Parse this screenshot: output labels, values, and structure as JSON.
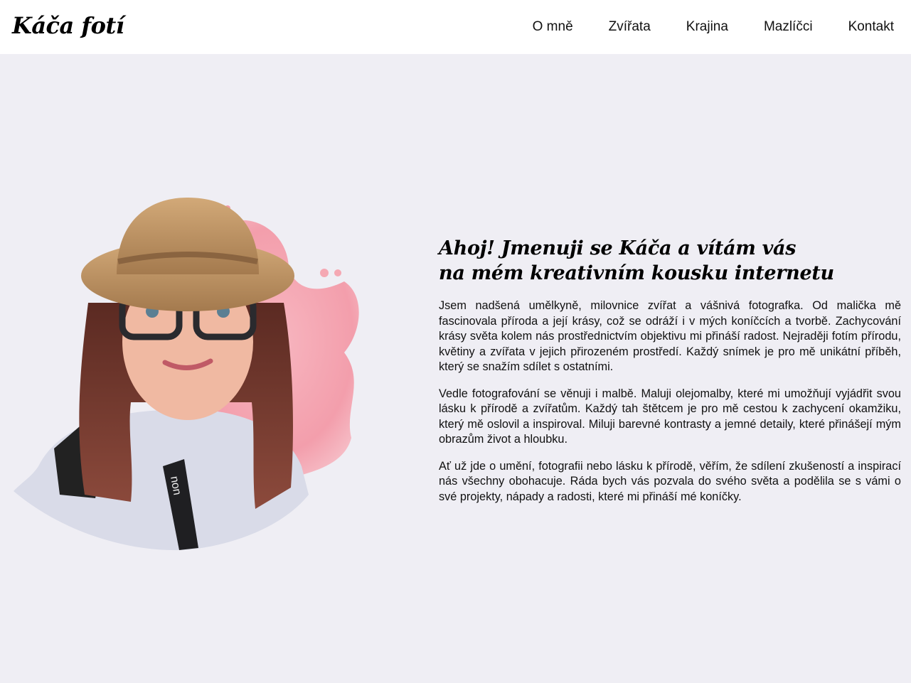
{
  "header": {
    "logo": "Káča fotí",
    "nav": [
      "O mně",
      "Zvířata",
      "Krajina",
      "Mazlíčci",
      "Kontakt"
    ]
  },
  "about": {
    "headline_line1": "Ahoj! Jmenuji se Káča a vítám vás",
    "headline_line2": "na mém kreativním kousku internetu",
    "paragraphs": [
      "Jsem nadšená umělkyně, milovnice zvířat a vášnivá fotografka. Od malička mě fascinovala příroda a její krásy, což se odráží i v mých koníčcích a tvorbě. Zachycování krásy světa kolem nás prostřednictvím objektivu mi přináší radost. Nejraději fotím přírodu, květiny a zvířata v jejich přirozeném prostředí. Každý snímek je pro mě unikátní příběh, který se snažím sdílet s ostatními.",
      "Vedle fotografování se věnuji i malbě. Maluji olejomalby, které mi umožňují vyjádřit svou lásku k přírodě a zvířatům. Každý tah štětcem je pro mě cestou k zachycení okamžiku, který mě oslovil a inspiroval. Miluji barevné kontrasty a jemné detaily, které přinášejí mým obrazům život a hloubku.",
      "Ať už jde o umění, fotografii nebo lásku k přírodě, věřím, že sdílení zkušeností a inspirací nás všechny obohacuje. Ráda bych vás pozvala do svého světa a podělila se s vámi o své projekty, nápady a radosti, které mi přináší mé koníčky."
    ],
    "camera_strap_text": "non"
  },
  "colors": {
    "page_bg": "#efeef4",
    "header_bg": "#ffffff",
    "watercolor": "#f39aa8",
    "text": "#111111"
  }
}
